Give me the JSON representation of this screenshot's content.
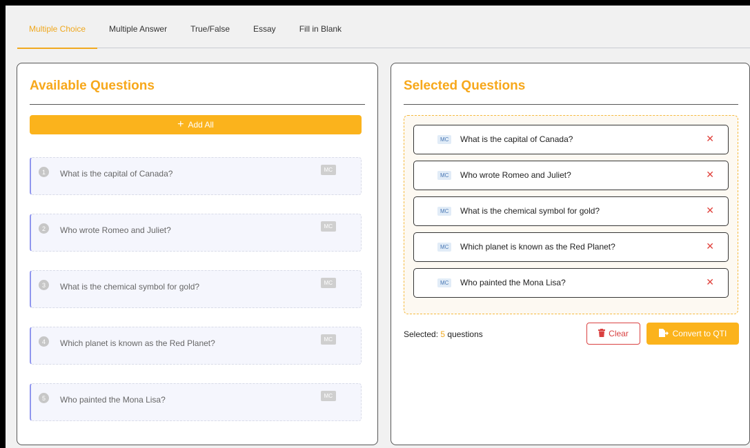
{
  "tabs": [
    {
      "label": "Multiple Choice",
      "active": true
    },
    {
      "label": "Multiple Answer",
      "active": false
    },
    {
      "label": "True/False",
      "active": false
    },
    {
      "label": "Essay",
      "active": false
    },
    {
      "label": "Fill in Blank",
      "active": false
    }
  ],
  "available": {
    "title": "Available Questions",
    "add_all_label": "Add All",
    "add_icon": "plus-icon",
    "items": [
      {
        "number": "1",
        "text": "What is the capital of Canada?",
        "type": "MC"
      },
      {
        "number": "2",
        "text": "Who wrote Romeo and Juliet?",
        "type": "MC"
      },
      {
        "number": "3",
        "text": "What is the chemical symbol for gold?",
        "type": "MC"
      },
      {
        "number": "4",
        "text": "Which planet is known as the Red Planet?",
        "type": "MC"
      },
      {
        "number": "5",
        "text": "Who painted the Mona Lisa?",
        "type": "MC"
      }
    ]
  },
  "selected": {
    "title": "Selected Questions",
    "remove_icon": "close-icon",
    "items": [
      {
        "tag": "MC",
        "text": "What is the capital of Canada?"
      },
      {
        "tag": "MC",
        "text": "Who wrote Romeo and Juliet?"
      },
      {
        "tag": "MC",
        "text": "What is the chemical symbol for gold?"
      },
      {
        "tag": "MC",
        "text": "Which planet is known as the Red Planet?"
      },
      {
        "tag": "MC",
        "text": "Who painted the Mona Lisa?"
      }
    ],
    "count_prefix": "Selected: ",
    "count": "5",
    "count_suffix": " questions",
    "clear_label": "Clear",
    "clear_icon": "trash-icon",
    "convert_label": "Convert to QTI",
    "convert_icon": "file-export-icon"
  },
  "colors": {
    "accent": "#fbb31c",
    "danger": "#d94040",
    "item_border_left": "#8f95ee"
  }
}
